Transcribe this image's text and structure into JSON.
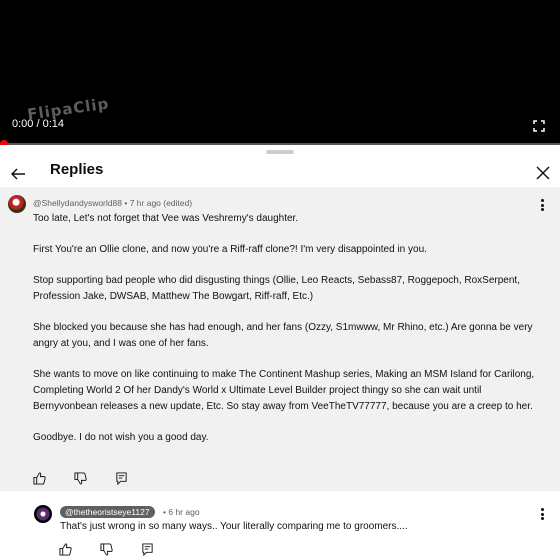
{
  "video": {
    "time": "0:00 / 0:14",
    "watermark": "FlipaClip"
  },
  "sheet": {
    "title": "Replies"
  },
  "main_comment": {
    "author": "@Shellydandysworld88",
    "time": "7 hr ago (edited)",
    "paragraphs": [
      "Too late, Let's not forget that Vee was Veshremy's daughter.",
      "First You're an Ollie clone, and now you're a Riff-raff clone?! I'm very disappointed in you.",
      "Stop supporting bad people who did disgusting things (Ollie, Leo Reacts, Sebass87, Roggepoch, RoxSerpent, Profession Jake, DWSAB, Matthew The Bowgart, Riff-raff, Etc.)",
      "She blocked you because she has had enough, and her fans (Ozzy, S1mwww, Mr Rhino, etc.) Are gonna be very angry at you, and I was one of her fans.",
      "She wants to move on like continuing to make The Continent Mashup series, Making an MSM Island for Carilong, Completing World 2 Of her Dandy's World x Ultimate Level Builder project thingy so she can wait until Bernyvonbean releases a new update, Etc. So stay away from VeeTheTV77777, because you are a creep to her.",
      "Goodbye. I do not wish you a good day."
    ]
  },
  "reply": {
    "author": "@thetheoristseye1127",
    "time": "6 hr ago",
    "text": "That's just wrong in so many ways.. Your literally comparing me to groomers...."
  },
  "separator": "•",
  "icons": [
    "fullscreen-icon",
    "back-arrow-icon",
    "close-icon",
    "kebab-menu-icon",
    "thumbs-up-icon",
    "thumbs-down-icon",
    "reply-icon"
  ]
}
